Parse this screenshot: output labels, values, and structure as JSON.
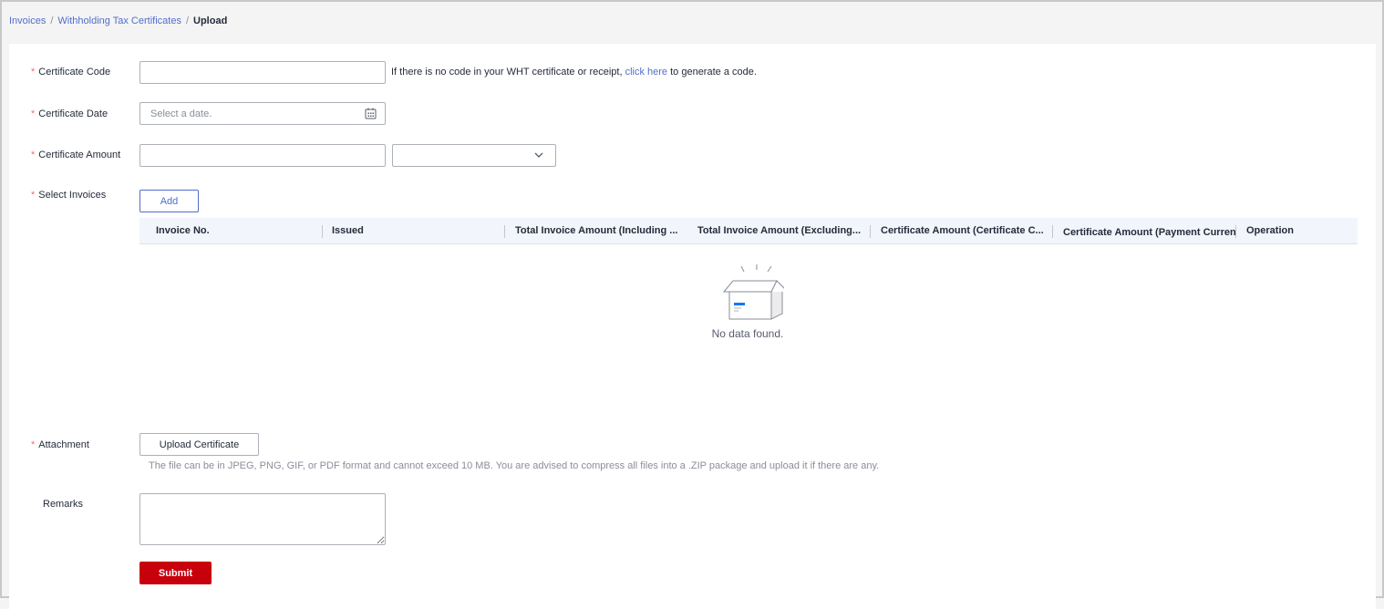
{
  "breadcrumb": {
    "items": [
      "Invoices",
      "Withholding Tax Certificates"
    ],
    "current": "Upload"
  },
  "form": {
    "certificate_code": {
      "label": "Certificate Code",
      "value": "",
      "hint_prefix": "If there is no code in your WHT certificate or receipt,",
      "hint_link": "click here",
      "hint_suffix": "to generate a code."
    },
    "certificate_date": {
      "label": "Certificate Date",
      "placeholder": "Select a date."
    },
    "certificate_amount": {
      "label": "Certificate Amount",
      "value": "",
      "currency": ""
    },
    "select_invoices": {
      "label": "Select Invoices",
      "add_label": "Add"
    },
    "attachment": {
      "label": "Attachment",
      "button": "Upload Certificate",
      "note": "The file can be in JPEG, PNG, GIF, or PDF format and cannot exceed 10 MB. You are advised to compress all files into a .ZIP package and upload it if there are any."
    },
    "remarks": {
      "label": "Remarks",
      "value": ""
    },
    "submit_label": "Submit"
  },
  "table": {
    "columns": [
      "Invoice No.",
      "Issued",
      "Total Invoice Amount (Including ...",
      "Total Invoice Amount (Excluding...",
      "Certificate Amount (Certificate C...",
      "Certificate Amount (Payment Currency",
      "Operation"
    ],
    "empty_text": "No data found."
  },
  "colors": {
    "accent": "#526ecc",
    "submit": "#c7000b",
    "required": "#f66f6a"
  }
}
